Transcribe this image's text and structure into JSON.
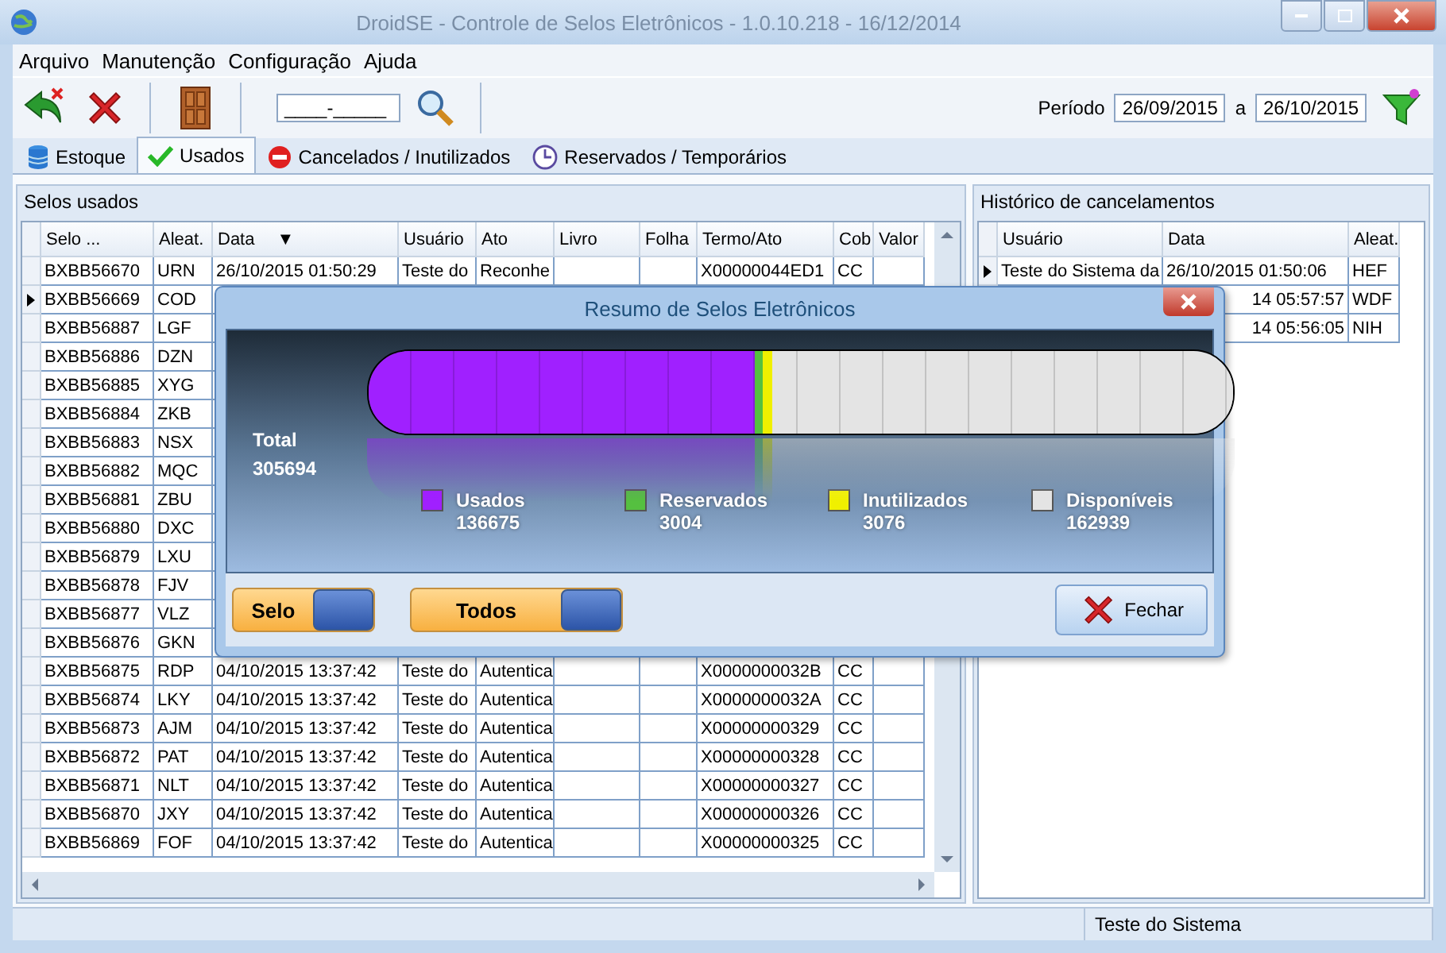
{
  "window": {
    "title": "DroidSE - Controle de Selos Eletrônicos - 1.0.10.218 - 16/12/2014"
  },
  "menu": [
    "Arquivo",
    "Manutenção",
    "Configuração",
    "Ajuda"
  ],
  "toolbar": {
    "code_field": "____-_____",
    "period_label": "Período",
    "date_from": "26/09/2015",
    "date_sep": "a",
    "date_to": "26/10/2015"
  },
  "tabs": [
    {
      "label": "Estoque",
      "selected": false
    },
    {
      "label": "Usados",
      "selected": true
    },
    {
      "label": "Cancelados / Inutilizados",
      "selected": false
    },
    {
      "label": "Reservados / Temporários",
      "selected": false
    }
  ],
  "used_panel": {
    "title": "Selos usados",
    "columns": [
      "Selo ...",
      "Aleat.",
      "Data",
      "Usuário",
      "Ato",
      "Livro",
      "Folha",
      "Termo/Ato",
      "Cob",
      "Valor"
    ],
    "sort_mark": "▼",
    "rows": [
      {
        "current": false,
        "cells": [
          "BXBB56670",
          "URN",
          "26/10/2015 01:50:29",
          "Teste do",
          "Reconhe",
          null,
          null,
          "X00000044ED1",
          "CC",
          null
        ]
      },
      {
        "current": true,
        "cells": [
          "BXBB56669",
          "COD"
        ]
      },
      {
        "current": false,
        "cells": [
          "BXBB56887",
          "LGF"
        ]
      },
      {
        "current": false,
        "cells": [
          "BXBB56886",
          "DZN"
        ]
      },
      {
        "current": false,
        "cells": [
          "BXBB56885",
          "XYG"
        ]
      },
      {
        "current": false,
        "cells": [
          "BXBB56884",
          "ZKB"
        ]
      },
      {
        "current": false,
        "cells": [
          "BXBB56883",
          "NSX"
        ]
      },
      {
        "current": false,
        "cells": [
          "BXBB56882",
          "MQC"
        ]
      },
      {
        "current": false,
        "cells": [
          "BXBB56881",
          "ZBU"
        ]
      },
      {
        "current": false,
        "cells": [
          "BXBB56880",
          "DXC"
        ]
      },
      {
        "current": false,
        "cells": [
          "BXBB56879",
          "LXU"
        ]
      },
      {
        "current": false,
        "cells": [
          "BXBB56878",
          "FJV"
        ]
      },
      {
        "current": false,
        "cells": [
          "BXBB56877",
          "VLZ"
        ]
      },
      {
        "current": false,
        "cells": [
          "BXBB56876",
          "GKN"
        ]
      },
      {
        "current": false,
        "cells": [
          "BXBB56875",
          "RDP",
          "04/10/2015 13:37:42",
          "Teste do",
          "Autentica",
          null,
          null,
          "X0000000032B",
          "CC",
          null
        ]
      },
      {
        "current": false,
        "cells": [
          "BXBB56874",
          "LKY",
          "04/10/2015 13:37:42",
          "Teste do",
          "Autentica",
          null,
          null,
          "X0000000032A",
          "CC",
          null
        ]
      },
      {
        "current": false,
        "cells": [
          "BXBB56873",
          "AJM",
          "04/10/2015 13:37:42",
          "Teste do",
          "Autentica",
          null,
          null,
          "X00000000329",
          "CC",
          null
        ]
      },
      {
        "current": false,
        "cells": [
          "BXBB56872",
          "PAT",
          "04/10/2015 13:37:42",
          "Teste do",
          "Autentica",
          null,
          null,
          "X00000000328",
          "CC",
          null
        ]
      },
      {
        "current": false,
        "cells": [
          "BXBB56871",
          "NLT",
          "04/10/2015 13:37:42",
          "Teste do",
          "Autentica",
          null,
          null,
          "X00000000327",
          "CC",
          null
        ]
      },
      {
        "current": false,
        "cells": [
          "BXBB56870",
          "JXY",
          "04/10/2015 13:37:42",
          "Teste do",
          "Autentica",
          null,
          null,
          "X00000000326",
          "CC",
          null
        ]
      },
      {
        "current": false,
        "cells": [
          "BXBB56869",
          "FOF",
          "04/10/2015 13:37:42",
          "Teste do",
          "Autentica",
          null,
          null,
          "X00000000325",
          "CC",
          null
        ]
      }
    ]
  },
  "history_panel": {
    "title": "Histórico de cancelamentos",
    "columns": [
      "Usuário",
      "Data",
      "Aleat."
    ],
    "rows": [
      {
        "current": true,
        "clipped": false,
        "cells": [
          "Teste do Sistema da",
          "26/10/2015 01:50:06",
          "HEF"
        ]
      },
      {
        "clipped": true,
        "cells": [
          "14 05:57:57",
          "WDF"
        ]
      },
      {
        "clipped": true,
        "cells": [
          "14 05:56:05",
          "NIH"
        ]
      }
    ]
  },
  "status_bar": [
    "Teste do Sistema"
  ],
  "dialog": {
    "title": "Resumo de Selos Eletrônicos",
    "total_label": "Total",
    "total": "305694",
    "legend": [
      {
        "label": "Usados",
        "value": "136675",
        "color": "#a020ff",
        "level": 0.447
      },
      {
        "label": "Reservados",
        "value": "3004",
        "color": "#55c040",
        "level": 0.0098
      },
      {
        "label": "Inutilizados",
        "value": "3076",
        "color": "#f0f000",
        "level": 0.0101
      },
      {
        "label": "Disponíveis",
        "value": "162939",
        "color": "#e4e4e4",
        "level": 0.533
      }
    ],
    "toggles": [
      {
        "label": "Selo",
        "on": true
      },
      {
        "label": "Todos",
        "on": true
      }
    ],
    "close_button": "Fechar"
  }
}
